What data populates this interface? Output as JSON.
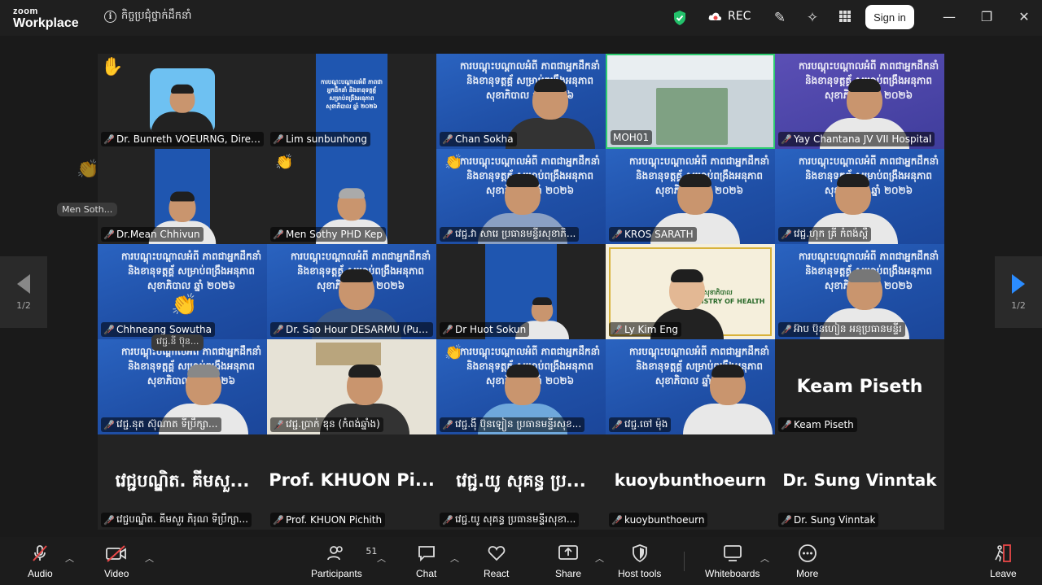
{
  "app": {
    "logo_top": "zoom",
    "logo_bottom": "Workplace"
  },
  "meeting": {
    "title": "កិច្ចប្រជុំថ្នាក់ដឹកនាំ"
  },
  "header": {
    "rec_label": "REC",
    "signin_label": "Sign in"
  },
  "pager": {
    "left": "1/2",
    "right": "1/2"
  },
  "banner_text": "ការបណ្តុះបណ្តាលអំពី ភាពជាអ្នកដឹកនាំ និងខានុទត្តគ្គ័ សម្រាប់ពង្រឹងអនុភាពសុខាភិបាល ឆ្នាំ ២០២៦",
  "moh_banner_text": "ក្រសួងសុខាភិបាល MINISTRY OF HEALTH",
  "tiles": [
    {
      "name": "Dr. Bunreth VOEURNG, Directo..."
    },
    {
      "name": "Lim sunbunhong"
    },
    {
      "name": "Chan Sokha"
    },
    {
      "name": "MOH01"
    },
    {
      "name": "Yay Chantana JV VII Hospital"
    },
    {
      "name": "Dr.Mean Chhivun"
    },
    {
      "name": "Men Sothy PHD Kep"
    },
    {
      "name": "វេជ្ជ.វា សារេ ប្រធានមន្ទីរសុខាភិ..."
    },
    {
      "name": "KROS SARATH"
    },
    {
      "name": "វេជ្ជ.ហុក គ្រី កំពង់ស្ពឺ"
    },
    {
      "name": "Chhneang Sowutha"
    },
    {
      "name": "Dr. Sao Hour DESARMU (Pursat..."
    },
    {
      "name": "Dr Huot Sokun"
    },
    {
      "name": "Ly Kim Eng"
    },
    {
      "name": "អ៊ាប ប៊ុនហៀន អនុប្រធានមន្ទីរ"
    },
    {
      "name": "វេជ្ជ.នុត ស៊ុណាត ទីប្រឹក្សា..."
    },
    {
      "name": "វេជ្ជ.ប្រាក់ ឌុន (កំពង់ឆ្នាំង)"
    },
    {
      "name": "វេជ្ជ.ង៉ី ប៊ុនឡៀន ប្រធានមន្ទីរសុខ..."
    },
    {
      "name": "វេជ្ជ.ចៅ ម៉ុង"
    },
    {
      "name": "Keam Piseth",
      "display": "Keam Piseth"
    },
    {
      "name": "វេជ្ជបណ្ឌិត. គីមសួរ ភិរុណ ទីប្រឹក្សា...",
      "display": "វេជ្ជបណ្ឌិត. គីមសួ..."
    },
    {
      "name": "Prof. KHUON Pichith",
      "display": "Prof. KHUON Pi..."
    },
    {
      "name": "វេជ្ជ.យូ សុគន្ធ ប្រធានមន្ទីរសុខា...",
      "display": "វេជ្ជ.យូ សុគន្ធ ប្រ..."
    },
    {
      "name": "kuoybunthoeurn",
      "display": "kuoybunthoeurn"
    },
    {
      "name": "Dr. Sung Vinntak",
      "display": "Dr. Sung Vinntak"
    }
  ],
  "overlays": {
    "men_soth": "Men Soth...",
    "tile16_chip": "វេជ្ជ.នី ប៊ុន..."
  },
  "toolbar": {
    "audio": "Audio",
    "video": "Video",
    "participants": "Participants",
    "participants_count": "51",
    "chat": "Chat",
    "react": "React",
    "share": "Share",
    "host_tools": "Host tools",
    "whiteboards": "Whiteboards",
    "more": "More",
    "leave": "Leave"
  },
  "colors": {
    "accent": "#2b8cff",
    "muted_red": "#e94848",
    "banner_blue": "#1f56b0",
    "active_border": "#2ecc71"
  }
}
